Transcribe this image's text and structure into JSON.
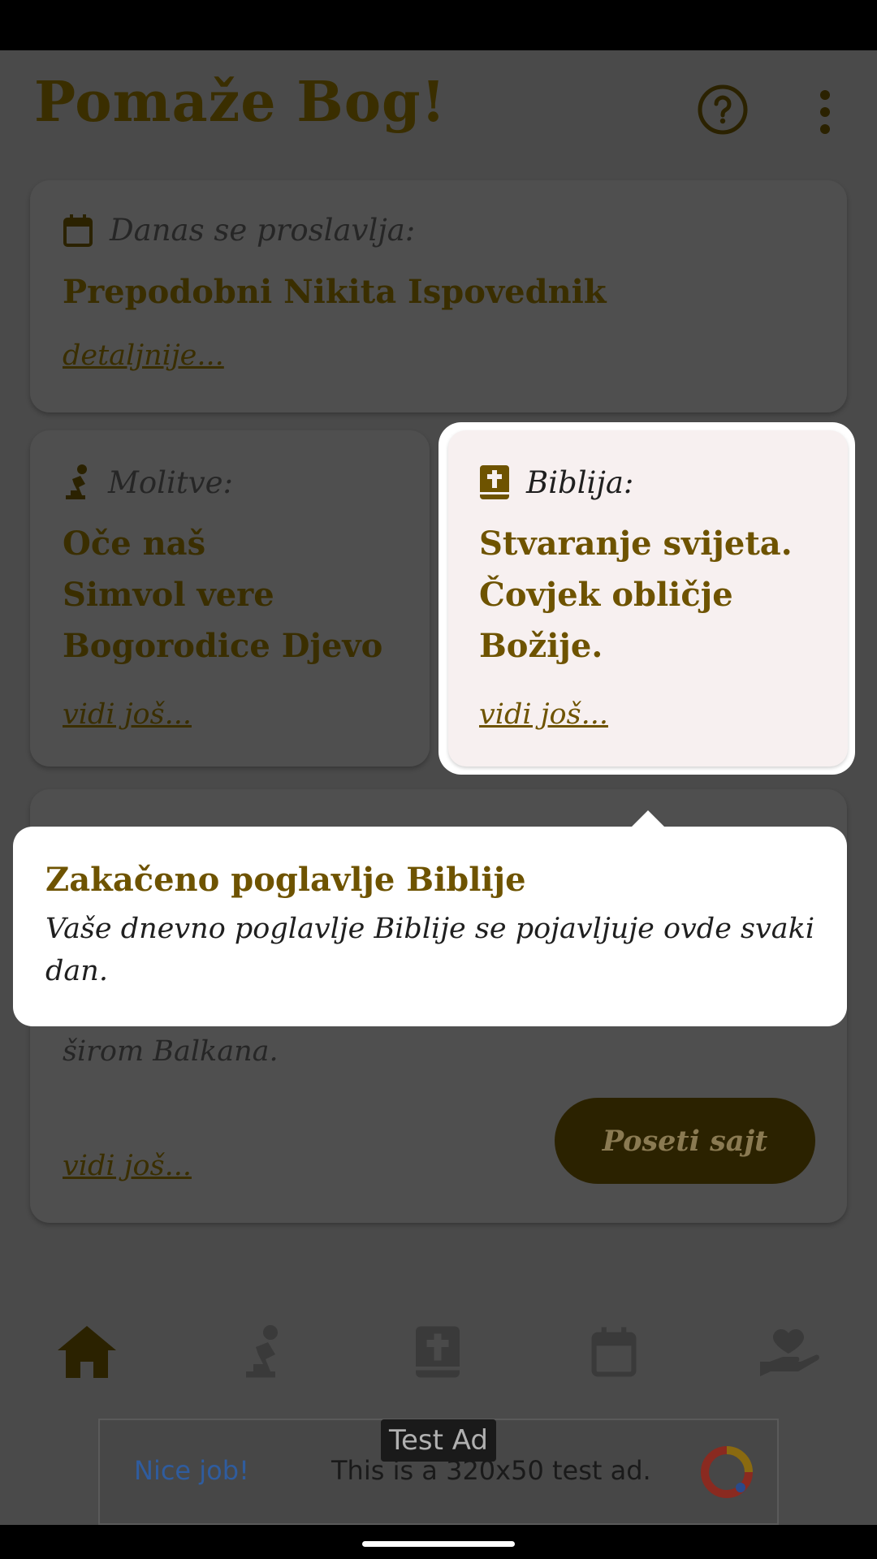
{
  "app": {
    "title": "Pomaže Bog!"
  },
  "today": {
    "header": "Danas se proslavlja:",
    "title": "Prepodobni Nikita Ispovednik",
    "link": "detaljnije..."
  },
  "prayers": {
    "header": "Molitve:",
    "items": [
      "Oče naš",
      "Simvol vere",
      "Bogorodice Djevo"
    ],
    "link": "vidi još..."
  },
  "bible": {
    "header": "Biblija:",
    "lines": [
      "Stvaranje svijeta.",
      "Čovjek obličje",
      "Božije."
    ],
    "link": "vidi još..."
  },
  "tooltip": {
    "title": "Zakačeno poglavlje Biblije",
    "text": "Vaše dnevno poglavlje Biblije se pojavljuje ovde svaki dan."
  },
  "info_card": {
    "partial_text": "širom Balkana.",
    "link": "vidi još...",
    "button": "Poseti sajt"
  },
  "bottom_nav": [
    "home-icon",
    "praying-icon",
    "bible-icon",
    "calendar-icon",
    "charity-icon"
  ],
  "ad": {
    "badge": "Test Ad",
    "left": "Nice job!",
    "text": "This is a 320x50 test ad."
  },
  "colors": {
    "accent": "#6e5300",
    "dim_overlay": "#4a4a4a"
  }
}
